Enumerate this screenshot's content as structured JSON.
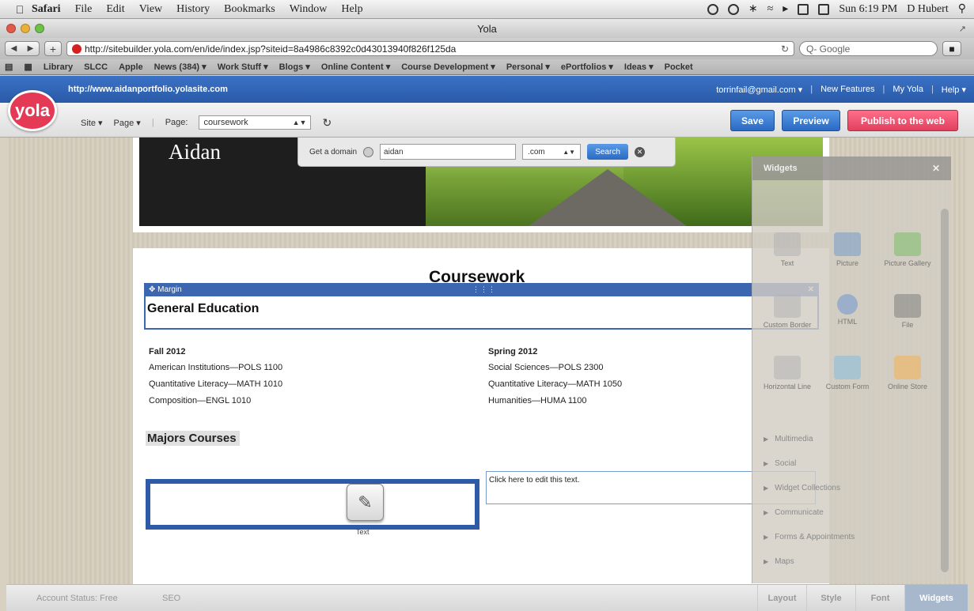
{
  "menubar": {
    "app": "Safari",
    "items": [
      "File",
      "Edit",
      "View",
      "History",
      "Bookmarks",
      "Window",
      "Help"
    ],
    "clock": "Sun 6:19 PM",
    "user": "D Hubert"
  },
  "window": {
    "title": "Yola"
  },
  "toolbar": {
    "url": "http://sitebuilder.yola.com/en/ide/index.jsp?siteid=8a4986c8392c0d43013940f826f125da",
    "search_placeholder": "Q- Google"
  },
  "bookmarks": [
    "Library",
    "SLCC",
    "Apple",
    "News (384) ▾",
    "Work Stuff ▾",
    "Blogs ▾",
    "Online Content ▾",
    "Course Development ▾",
    "Personal ▾",
    "ePortfolios ▾",
    "Ideas ▾",
    "Pocket"
  ],
  "yola": {
    "logo": "yola",
    "site_url": "http://www.aidanportfolio.yolasite.com",
    "email": "torrinfail@gmail.com ▾",
    "links": [
      "New Features",
      "My Yola",
      "Help ▾"
    ],
    "site_menu": "Site ▾",
    "page_menu": "Page ▾",
    "page_label": "Page:",
    "page_value": "coursework",
    "save": "Save",
    "preview": "Preview",
    "publish": "Publish to the web"
  },
  "header": {
    "site_title": "Aidan",
    "domain_label": "Get a domain",
    "domain_value": "aidan",
    "domain_ext": ".com",
    "search_btn": "Search"
  },
  "page": {
    "title": "Coursework",
    "margin_label": "Margin",
    "section1": "General Education",
    "fall": {
      "term": "Fall 2012",
      "courses": [
        "American Institutions—POLS 1100",
        "Quantitative Literacy—MATH 1010",
        "Composition—ENGL 1010"
      ]
    },
    "spring": {
      "term": "Spring 2012",
      "courses": [
        "Social Sciences—POLS 2300",
        "Quantitative Literacy—MATH 1050",
        "Humanities—HUMA 1100"
      ]
    },
    "section2": "Majors Courses",
    "tool_label": "Text",
    "edit_text": "Click here to edit this text."
  },
  "widgets": {
    "title": "Widgets",
    "items": [
      "Text",
      "Picture",
      "Picture Gallery",
      "Custom Border",
      "HTML",
      "File",
      "Horizontal Line",
      "Custom Form",
      "Online Store"
    ],
    "sections": [
      "Multimedia",
      "Social",
      "Widget Collections",
      "Communicate",
      "Forms & Appointments",
      "Maps"
    ]
  },
  "bottom": {
    "account": "Account Status: Free",
    "seo": "SEO",
    "tabs": [
      "Layout",
      "Style",
      "Font",
      "Widgets"
    ]
  }
}
